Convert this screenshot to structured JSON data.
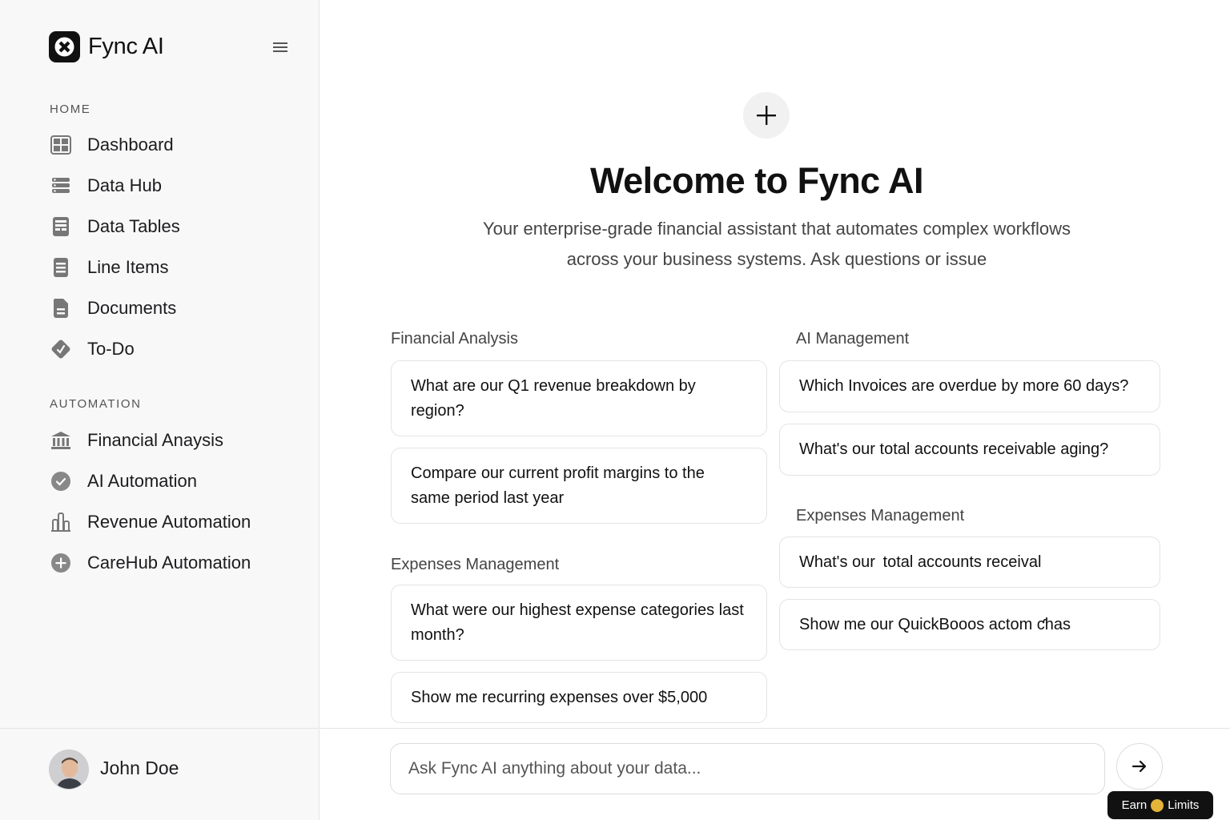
{
  "brand": {
    "name": "Fync AI"
  },
  "sidebar": {
    "sections": [
      {
        "label": "HOME"
      },
      {
        "label": "AUTOMATION"
      }
    ],
    "home_items": [
      {
        "label": "Dashboard",
        "icon": "dashboard-grid-icon"
      },
      {
        "label": "Data Hub",
        "icon": "database-icon"
      },
      {
        "label": "Data Tables",
        "icon": "table-icon"
      },
      {
        "label": "Line Items",
        "icon": "document-lines-icon"
      },
      {
        "label": "Documents",
        "icon": "document-icon"
      },
      {
        "label": "To-Do",
        "icon": "todo-diamond-icon"
      }
    ],
    "automation_items": [
      {
        "label": "Financial Anaysis",
        "icon": "bank-icon"
      },
      {
        "label": "AI Automation",
        "icon": "check-circle-icon"
      },
      {
        "label": "Revenue Automation",
        "icon": "bar-chart-icon"
      },
      {
        "label": "CareHub Automation",
        "icon": "plus-circle-icon"
      }
    ],
    "user": {
      "name": "John Doe"
    }
  },
  "main": {
    "title": "Welcome to Fync AI",
    "subtitle": "Your enterprise-grade financial assistant that automates complex workflows across your business systems. Ask questions or issue",
    "left_groups": [
      {
        "title": "Financial Analysis",
        "prompts": [
          "What are our Q1 revenue breakdown by region?",
          "Compare our current profit margins to the same period last year"
        ]
      },
      {
        "title": "Expenses Management",
        "prompts": [
          "What were our highest expense categories last month?",
          "Show me recurring expenses over $5,000"
        ]
      }
    ],
    "right_groups": [
      {
        "title": "AI Management",
        "prompts": [
          "Which Invoices are overdue by more 60 days?",
          "What's our total accounts receivable aging?"
        ]
      },
      {
        "title": "Expenses Management",
        "prompts": [
          "What's our  total accounts receival",
          "Show me our QuickBooos actom ƈhas"
        ]
      }
    ],
    "input": {
      "placeholder": "Ask Fync AI anything about your data..."
    }
  },
  "badge": {
    "earn": "Earn",
    "limits": "Limits"
  },
  "colors": {
    "accent": "#111111",
    "sidebar_bg": "#f8f8f9",
    "border": "#e4e4e7",
    "coin": "#e4b43a"
  }
}
